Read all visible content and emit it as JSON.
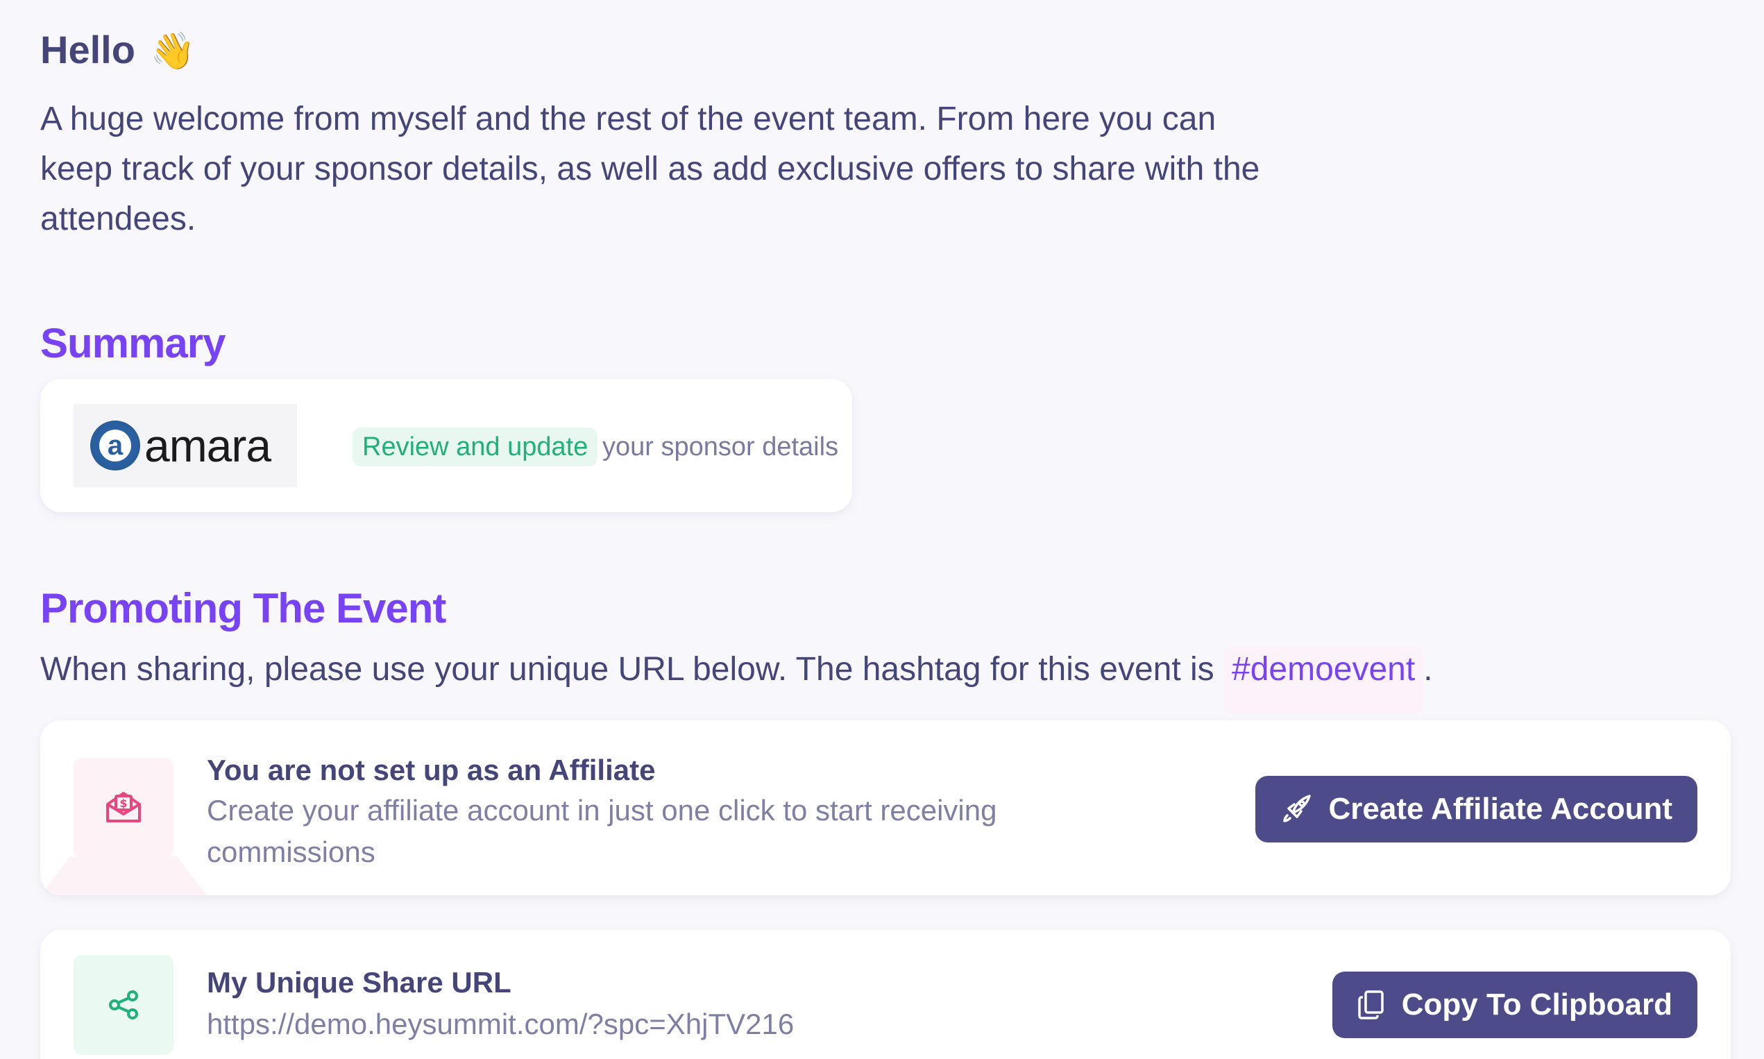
{
  "greeting": {
    "text": "Hello",
    "emoji": "👋"
  },
  "intro": "A huge welcome from myself and the rest of the event team. From here you can keep track of your sponsor details, as well as add exclusive offers to share with the attendees.",
  "summary": {
    "heading": "Summary",
    "logo": {
      "mark": "a",
      "wordmark": "amara"
    },
    "review_link": "Review and update",
    "review_tail": "your sponsor details"
  },
  "promoting": {
    "heading": "Promoting The Event",
    "text": "When sharing, please use your unique URL below. The hashtag for this event is",
    "hashtag": "#demoevent",
    "period": "."
  },
  "affiliate": {
    "icon": "envelope-dollar-icon",
    "title": "You are not set up as an Affiliate",
    "subtitle": "Create your affiliate account in just one click to start receiving commissions",
    "button_icon": "rocket-icon",
    "button_label": "Create Affiliate Account"
  },
  "share_url": {
    "icon": "share-icon",
    "title": "My Unique Share URL",
    "url": "https://demo.heysummit.com/?spc=XhjTV216",
    "button_icon": "clipboard-icon",
    "button_label": "Copy To Clipboard"
  },
  "colors": {
    "accent": "#7843f5",
    "text": "#45457a",
    "button": "#4e4b8a",
    "success": "#22b07a",
    "pink": "#e8467c"
  }
}
